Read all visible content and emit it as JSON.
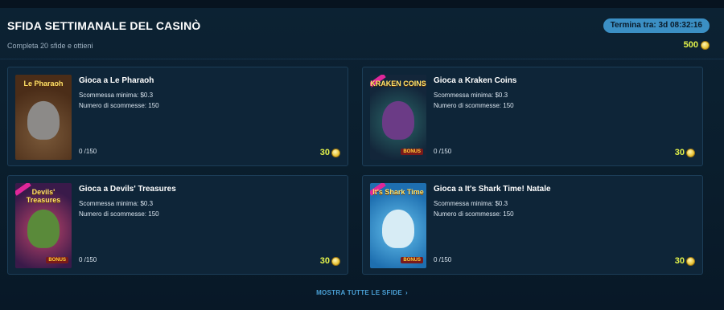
{
  "header": {
    "title": "SFIDA SETTIMANALE DEL CASINÒ",
    "subtitle": "Completa 20 sfide e ottieni",
    "timer": "Termina tra: 3d 08:32:16",
    "reward": "500"
  },
  "challenges": [
    {
      "title": "Gioca a Le Pharaoh",
      "min_bet": "Scommessa minima: $0.3",
      "bets": "Numero di scommesse: 150",
      "progress": "0 /150",
      "reward": "30",
      "logo": "Le Pharaoh"
    },
    {
      "title": "Gioca a Kraken Coins",
      "min_bet": "Scommessa minima: $0.3",
      "bets": "Numero di scommesse: 150",
      "progress": "0 /150",
      "reward": "30",
      "logo": "KRAKEN COINS"
    },
    {
      "title": "Gioca a Devils' Treasures",
      "min_bet": "Scommessa minima: $0.3",
      "bets": "Numero di scommesse: 150",
      "progress": "0 /150",
      "reward": "30",
      "logo": "Devils' Treasures"
    },
    {
      "title": "Gioca a It's Shark Time! Natale",
      "min_bet": "Scommessa minima: $0.3",
      "bets": "Numero di scommesse: 150",
      "progress": "0 /150",
      "reward": "30",
      "logo": "It's Shark Time"
    }
  ],
  "footer": {
    "show_all": "MOSTRA TUTTE LE SFIDE"
  },
  "colors": {
    "accent": "#3b8fc4",
    "reward": "#e3f34a",
    "link": "#4aa0d6"
  }
}
